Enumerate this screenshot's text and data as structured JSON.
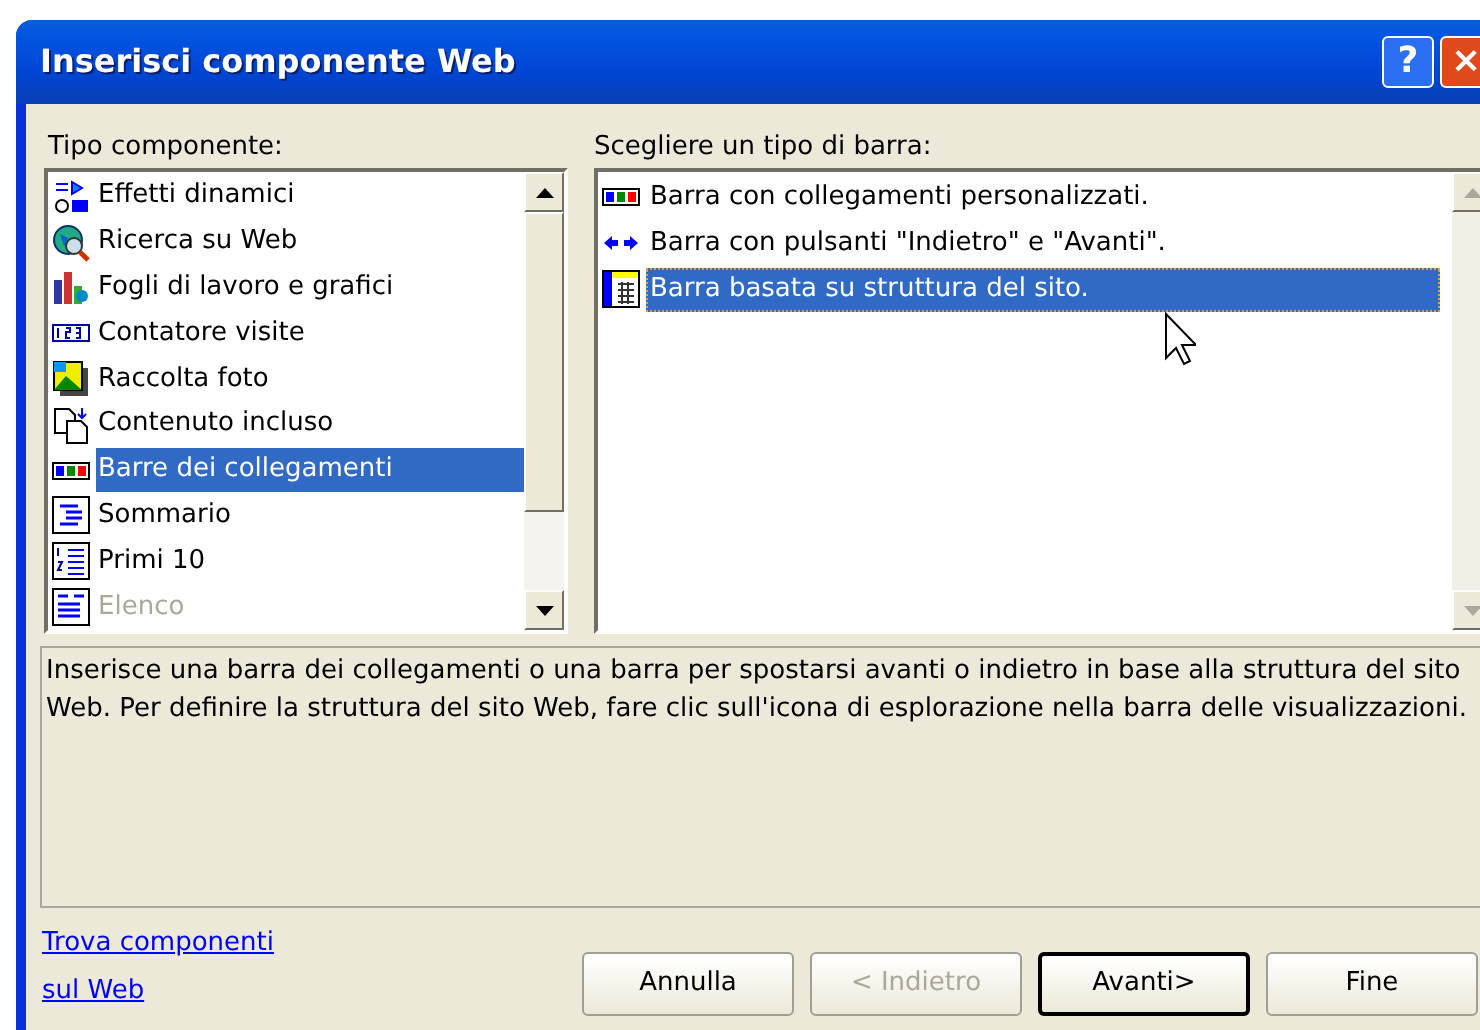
{
  "window": {
    "title": "Inserisci componente Web"
  },
  "title_buttons": [
    {
      "kind": "help",
      "label": "?"
    },
    {
      "kind": "close",
      "label": "×"
    }
  ],
  "component_type": {
    "label": "Tipo componente:",
    "scroll_enabled": true,
    "items": [
      {
        "label": "Effetti dinamici",
        "kind": "effects",
        "selected": false,
        "disabled": false
      },
      {
        "label": "Ricerca su Web",
        "kind": "globe",
        "selected": false,
        "disabled": false
      },
      {
        "label": "Fogli di lavoro e grafici",
        "kind": "chart",
        "selected": false,
        "disabled": false
      },
      {
        "label": "Contatore visite",
        "kind": "counter",
        "selected": false,
        "disabled": false
      },
      {
        "label": "Raccolta foto",
        "kind": "photo",
        "selected": false,
        "disabled": false
      },
      {
        "label": "Contenuto incluso",
        "kind": "pages",
        "selected": false,
        "disabled": false
      },
      {
        "label": "Barre dei collegamenti",
        "kind": "linkbar",
        "selected": true,
        "disabled": false
      },
      {
        "label": "Sommario",
        "kind": "toc",
        "selected": false,
        "disabled": false
      },
      {
        "label": "Primi 10",
        "kind": "numlist",
        "selected": false,
        "disabled": false
      },
      {
        "label": "Elenco",
        "kind": "list",
        "selected": false,
        "disabled": true
      }
    ]
  },
  "bar_type": {
    "label": "Scegliere un tipo di barra:",
    "scroll_enabled": false,
    "items": [
      {
        "label": "Barra con collegamenti personalizzati.",
        "kind": "linkbar",
        "selected": false
      },
      {
        "label": "Barra con pulsanti \"Indietro\" e \"Avanti\".",
        "kind": "arrows",
        "selected": false
      },
      {
        "label": "Barra basata su struttura del sito.",
        "kind": "sitemap",
        "selected": true
      }
    ]
  },
  "description": "Inserisce una barra dei collegamenti o una barra per spostarsi avanti o indietro in base alla struttura del sito Web. Per definire la struttura del sito Web, fare clic sull'icona di esplorazione nella barra delle visualizzazioni.",
  "link": [
    "Trova componenti",
    "sul Web"
  ],
  "buttons": [
    {
      "label": "Annulla",
      "disabled": false,
      "default": false
    },
    {
      "label": "< Indietro",
      "disabled": true,
      "default": false
    },
    {
      "label": "Avanti>",
      "disabled": false,
      "default": true
    },
    {
      "label": "Fine",
      "disabled": false,
      "default": false
    }
  ]
}
